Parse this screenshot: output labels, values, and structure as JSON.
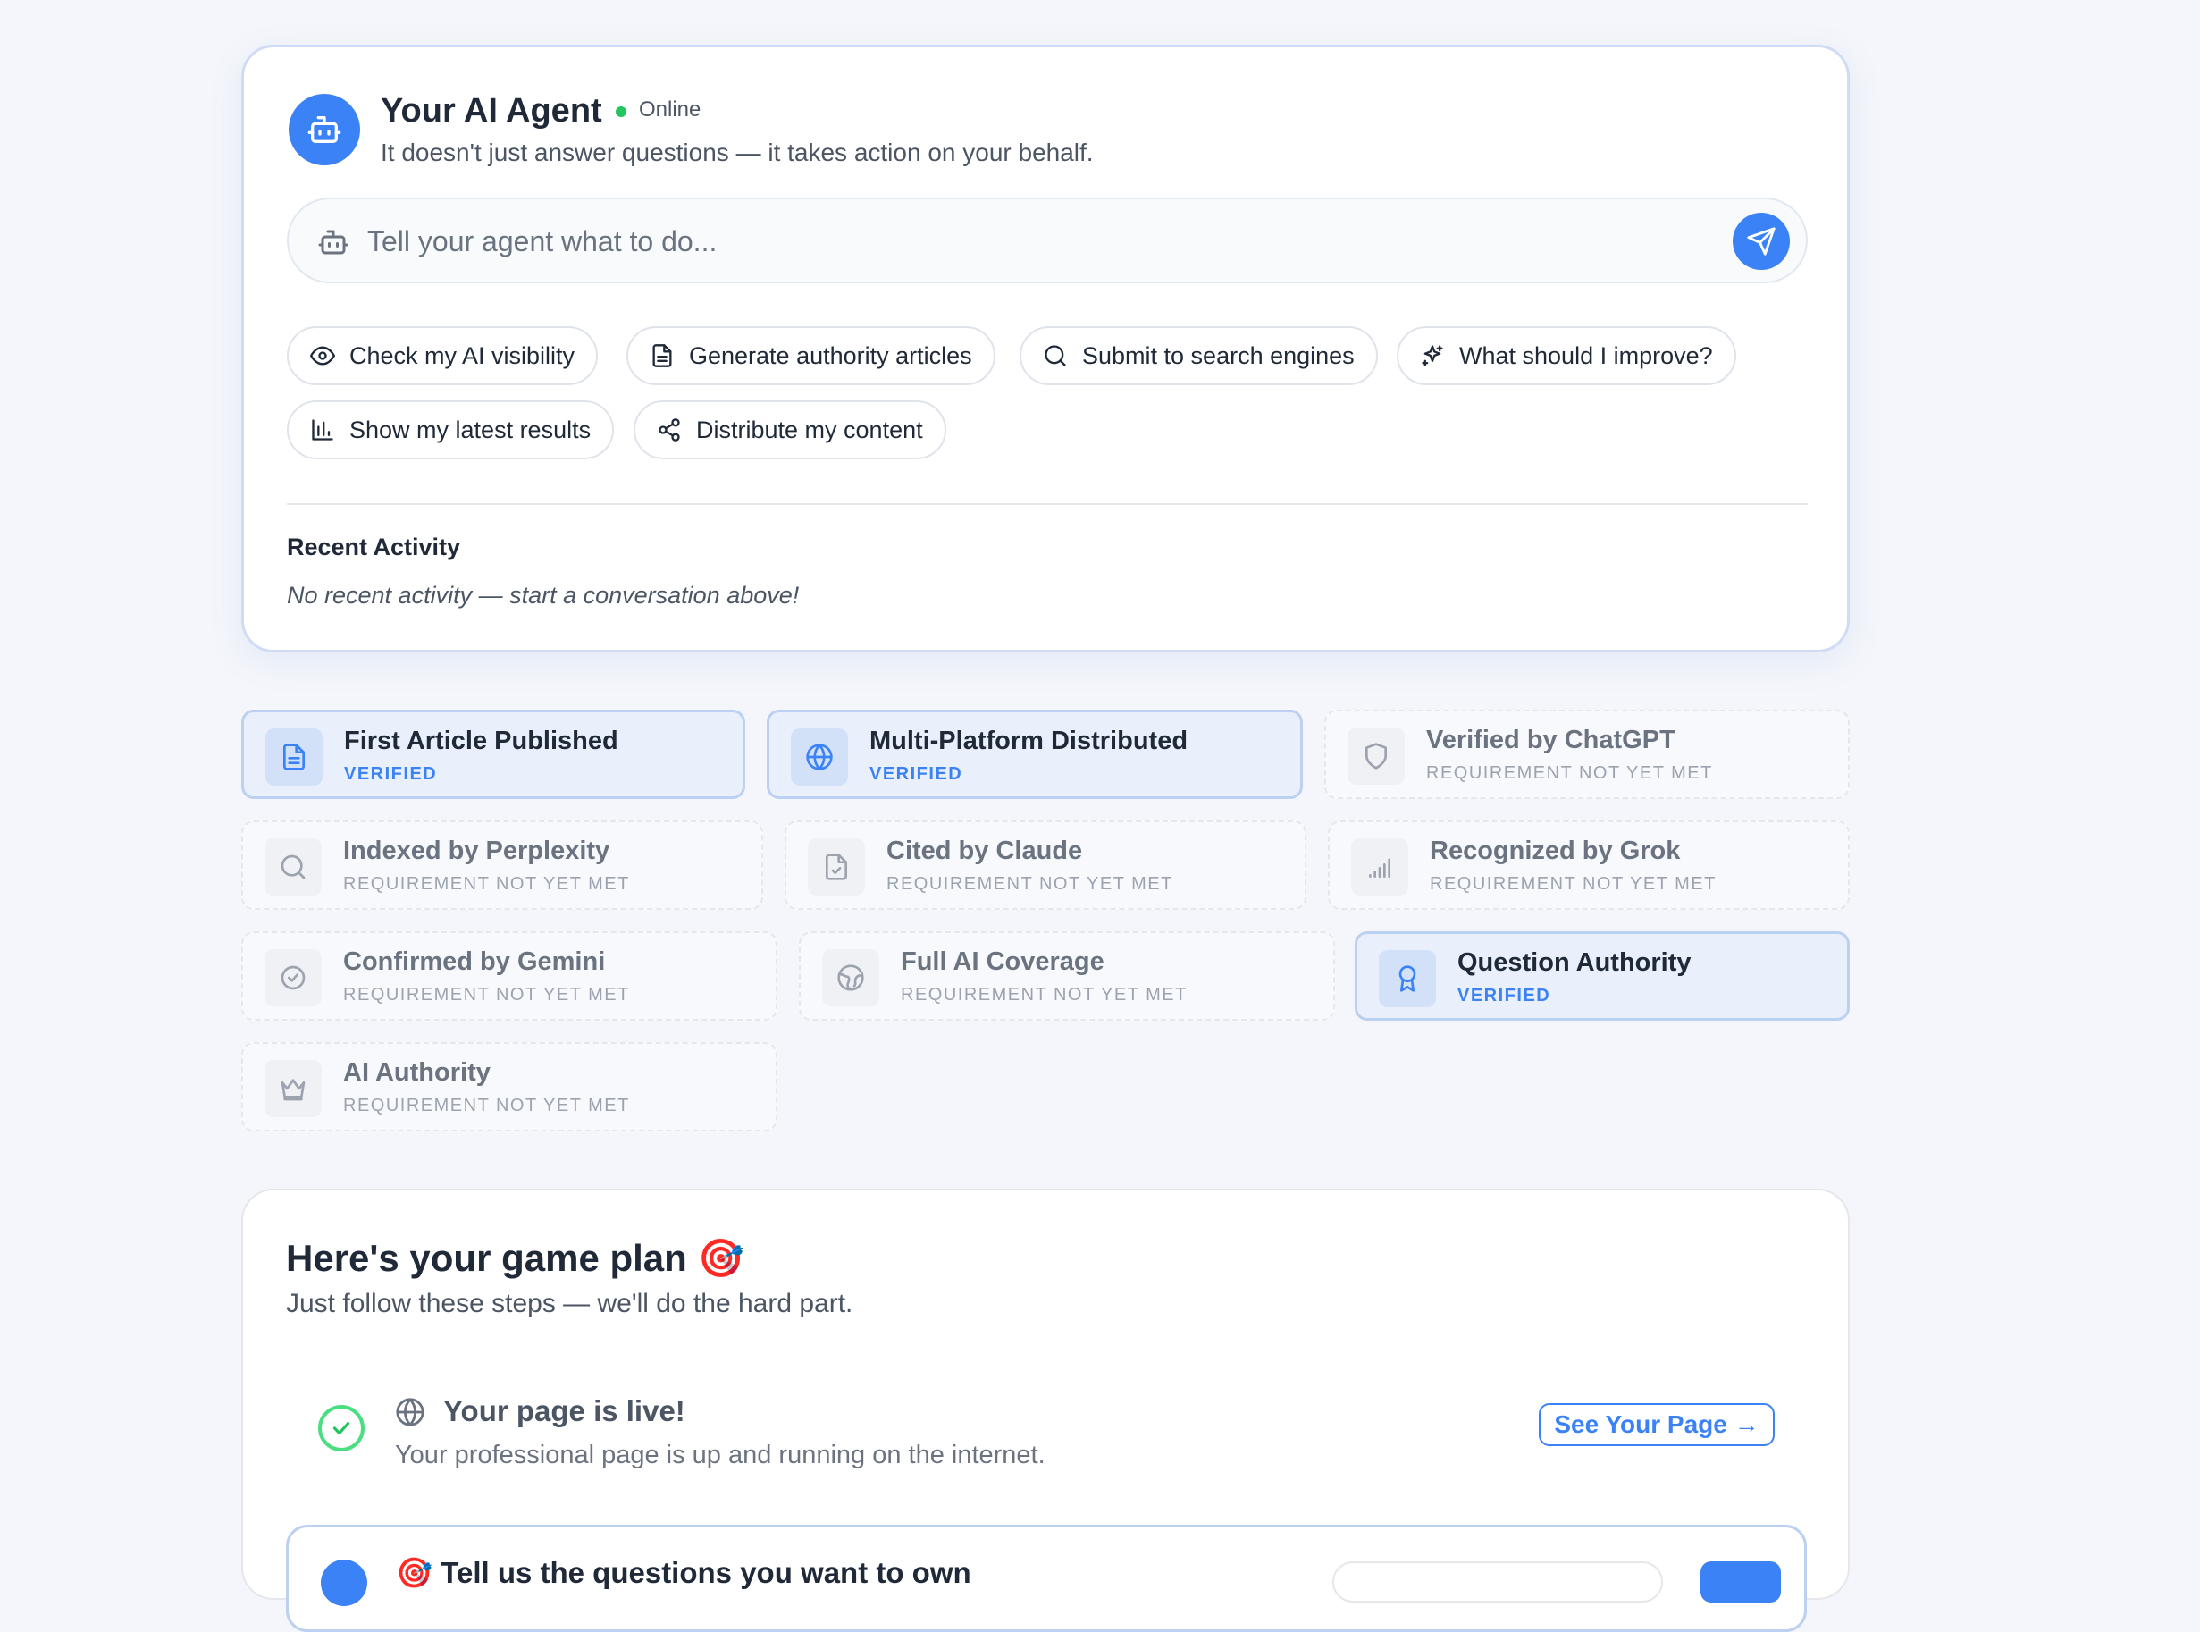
{
  "agent": {
    "title": "Your AI Agent",
    "status": "Online",
    "subtitle": "It doesn't just answer questions — it takes action on your behalf.",
    "input_placeholder": "Tell your agent what to do...",
    "accent": "#3b82f6",
    "status_color": "#22c55e"
  },
  "chips": [
    {
      "label": "Check my AI visibility",
      "icon": "eye-icon"
    },
    {
      "label": "Generate authority articles",
      "icon": "document-icon"
    },
    {
      "label": "Submit to search engines",
      "icon": "search-icon"
    },
    {
      "label": "What should I improve?",
      "icon": "sparkles-icon"
    },
    {
      "label": "Show my latest results",
      "icon": "bar-chart-icon"
    },
    {
      "label": "Distribute my content",
      "icon": "share-icon"
    }
  ],
  "recent": {
    "title": "Recent Activity",
    "empty": "No recent activity — start a conversation above!"
  },
  "badges": [
    {
      "title": "First Article Published",
      "status": "VERIFIED",
      "verified": true,
      "icon": "document-icon"
    },
    {
      "title": "Multi-Platform Distributed",
      "status": "VERIFIED",
      "verified": true,
      "icon": "globe-icon"
    },
    {
      "title": "Verified by ChatGPT",
      "status": "REQUIREMENT NOT YET MET",
      "verified": false,
      "icon": "shield-icon"
    },
    {
      "title": "Indexed by Perplexity",
      "status": "REQUIREMENT NOT YET MET",
      "verified": false,
      "icon": "search-icon"
    },
    {
      "title": "Cited by Claude",
      "status": "REQUIREMENT NOT YET MET",
      "verified": false,
      "icon": "file-check-icon"
    },
    {
      "title": "Recognized by Grok",
      "status": "REQUIREMENT NOT YET MET",
      "verified": false,
      "icon": "signal-icon"
    },
    {
      "title": "Confirmed by Gemini",
      "status": "REQUIREMENT NOT YET MET",
      "verified": false,
      "icon": "badge-check-icon"
    },
    {
      "title": "Full AI Coverage",
      "status": "REQUIREMENT NOT YET MET",
      "verified": false,
      "icon": "world-icon"
    },
    {
      "title": "Question Authority",
      "status": "VERIFIED",
      "verified": true,
      "icon": "award-icon"
    },
    {
      "title": "AI Authority",
      "status": "REQUIREMENT NOT YET MET",
      "verified": false,
      "icon": "crown-icon"
    }
  ],
  "plan": {
    "title": "Here's your game plan 🎯",
    "subtitle": "Just follow these steps — we'll do the hard part.",
    "step1": {
      "title": "Your page is live!",
      "desc": "Your professional page is up and running on the internet.",
      "button": "See Your Page →"
    },
    "step2": {
      "title": "🎯 Tell us the questions you want to own"
    }
  }
}
